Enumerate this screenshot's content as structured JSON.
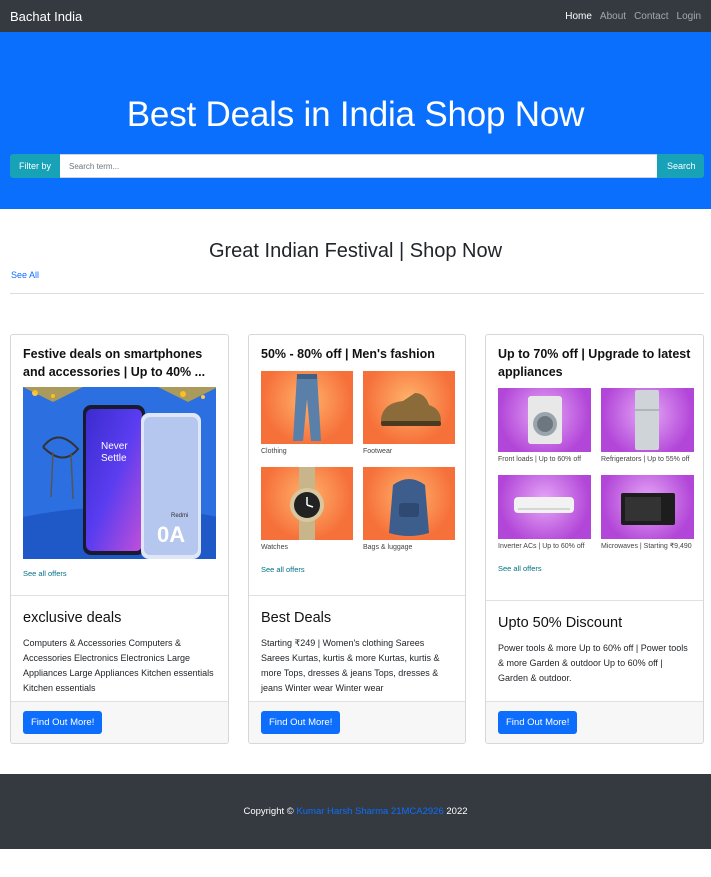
{
  "nav": {
    "brand": "Bachat India",
    "links": [
      "Home",
      "About",
      "Contact",
      "Login"
    ]
  },
  "hero": {
    "title": "Best Deals in India Shop Now",
    "filter_label": "Filter by",
    "search_placeholder": "Search term...",
    "search_button": "Search"
  },
  "section": {
    "title": "Great Indian Festival | Shop Now",
    "see_all": "See All"
  },
  "cards": [
    {
      "ad_title": "Festive deals on smartphones and accessories | Up to 40% ...",
      "ad_link": "See all offers",
      "phone_text_1": "Never",
      "phone_text_2": "Settle",
      "phone_brand": "Redmi",
      "phone_model": "0A",
      "title": "exclusive deals",
      "text": "Computers & Accessories Computers & Accessories Electronics Electronics Large Appliances Large Appliances Kitchen essentials Kitchen essentials",
      "button": "Find Out More!"
    },
    {
      "ad_title": "50% - 80% off | Men's fashion",
      "tiles": [
        "Clothing",
        "Footwear",
        "Watches",
        "Bags & luggage"
      ],
      "ad_link": "See all offers",
      "title": "Best Deals",
      "text": "Starting ₹249 | Women's clothing Sarees Sarees Kurtas, kurtis & more Kurtas, kurtis & more Tops, dresses & jeans Tops, dresses & jeans Winter wear Winter wear",
      "button": "Find Out More!"
    },
    {
      "ad_title": "Up to 70% off | Upgrade to latest appliances",
      "tiles": [
        "Front loads | Up to 60% off",
        "Refrigerators | Up to 55% off",
        "Inverter ACs | Up to 60% off",
        "Microwaves | Starting ₹9,490"
      ],
      "ad_link": "See all offers",
      "title": "Upto 50% Discount",
      "text": "Power tools & more Up to 60% off | Power tools & more Garden & outdoor Up to 60% off | Garden & outdoor.",
      "button": "Find Out More!"
    }
  ],
  "footer": {
    "prefix": "Copyright ©",
    "author": "Kumar Harsh Sharma 21MCA2926",
    "year": "2022"
  },
  "colors": {
    "navbar": "#343a40",
    "hero": "#0a6ffd",
    "info": "#17a2b8",
    "primary": "#0d6efd"
  }
}
